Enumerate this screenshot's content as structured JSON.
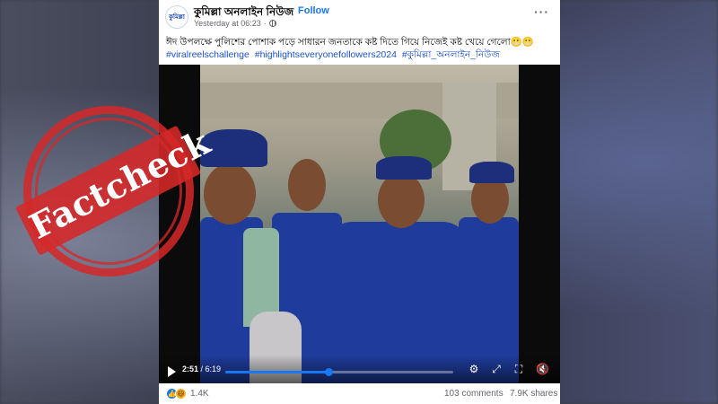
{
  "post": {
    "page_name": "কুমিল্লা অনলাইন নিউজ",
    "follow_label": "Follow",
    "separator": "·",
    "timestamp": "Yesterday at 06:23",
    "avatar_text": "কুমিল্লা",
    "more_label": "···",
    "caption": "ঈদ উপলক্ষে পুলিশের পোশাক পড়ে সাধারন জনতাকে কষ্ট দিতে গিয়ে নিজেই কষ্ট খেয়ে গেলো😬😬",
    "hashtags": [
      "#viralreelschallenge",
      "#highlightseveryonefollowers2024",
      "#কুমিল্লা_অনলাইন_নিউজ"
    ]
  },
  "video": {
    "current_time": "2:51",
    "duration": "6:19",
    "progress_fraction": 0.451
  },
  "engagement": {
    "reaction_count": "1.4K",
    "comments": "103 comments",
    "shares": "7.9K shares"
  },
  "stamp": {
    "text": "Factcheck",
    "color": "#d62828"
  },
  "colors": {
    "accent": "#1877f2",
    "hashtag": "#1c52c7",
    "secondary_text": "#65676b"
  }
}
